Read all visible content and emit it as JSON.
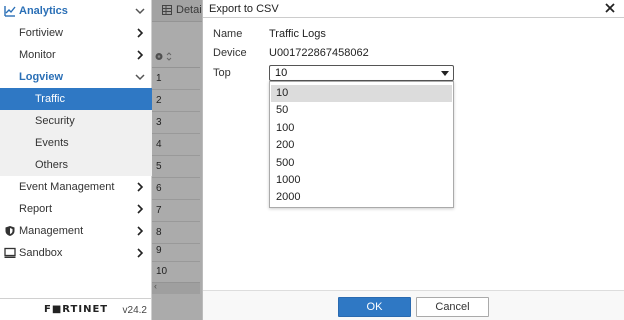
{
  "sidebar": {
    "analytics_label": "Analytics",
    "fortiview_label": "Fortiview",
    "monitor_label": "Monitor",
    "logview_label": "Logview",
    "logview_items": [
      "Traffic",
      "Security",
      "Events",
      "Others"
    ],
    "event_management_label": "Event Management",
    "report_label": "Report",
    "management_label": "Management",
    "sandbox_label": "Sandbox",
    "brand": "F■RTINET",
    "version": "v24.2"
  },
  "background": {
    "details_label": "Detail",
    "row_numbers": [
      "1",
      "2",
      "3",
      "4",
      "5",
      "6",
      "7",
      "8",
      "9",
      "10"
    ]
  },
  "dialog": {
    "title": "Export to CSV",
    "name_label": "Name",
    "name_value": "Traffic Logs",
    "device_label": "Device",
    "device_value": "U001722867458062",
    "top_label": "Top",
    "top_selected": "10",
    "top_options": [
      "10",
      "50",
      "100",
      "200",
      "500",
      "1000",
      "2000"
    ],
    "ok_label": "OK",
    "cancel_label": "Cancel"
  },
  "colors": {
    "accent": "#2f78c4",
    "nav_active_text": "#2a6fb6"
  }
}
